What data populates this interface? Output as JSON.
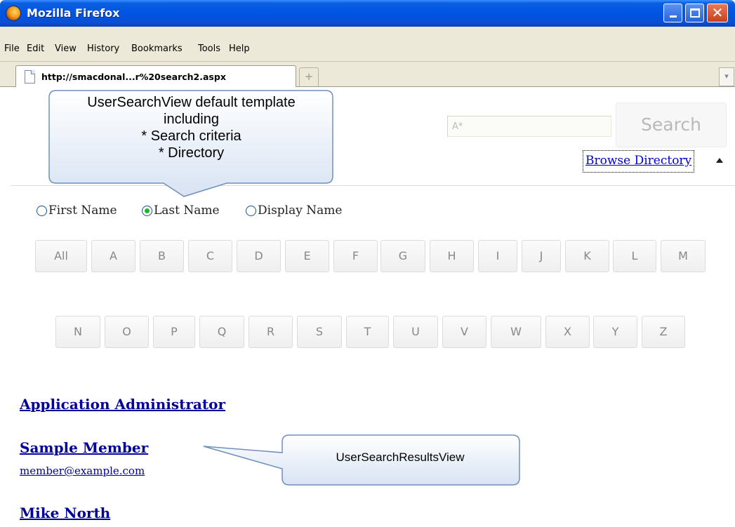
{
  "window": {
    "title": "Mozilla Firefox",
    "buttons": {
      "minimize": "_",
      "maximize": "□",
      "close": "✕"
    }
  },
  "menu": [
    "File",
    "Edit",
    "View",
    "History",
    "Bookmarks",
    "Tools",
    "Help"
  ],
  "tab": {
    "label": "http://smacdonal...r%20search2.aspx",
    "new_tab": "+",
    "list": "▾"
  },
  "search": {
    "value": "A*",
    "button": "Search"
  },
  "browse": {
    "label": "Browse Directory"
  },
  "radio_options": [
    {
      "label": "First Name",
      "checked": false
    },
    {
      "label": "Last Name",
      "checked": true
    },
    {
      "label": "Display Name",
      "checked": false
    }
  ],
  "letters_row1": [
    "All",
    "A",
    "B",
    "C",
    "D",
    "E",
    "F",
    "G",
    "H",
    "I",
    "J",
    "K",
    "L",
    "M"
  ],
  "letters_row2": [
    "N",
    "O",
    "P",
    "Q",
    "R",
    "S",
    "T",
    "U",
    "V",
    "W",
    "X",
    "Y",
    "Z"
  ],
  "results": [
    {
      "name": "Application Administrator"
    },
    {
      "name": "Sample Member",
      "email": "member@example.com"
    },
    {
      "name": "Mike North"
    }
  ],
  "callouts": {
    "template": [
      "UserSearchView default template",
      "including",
      "* Search criteria",
      "* Directory"
    ],
    "results_view": "UserSearchResultsView"
  },
  "colors": {
    "titlebar": "#0054e3",
    "link": "#000099",
    "radio_checked": "#1fb330"
  }
}
